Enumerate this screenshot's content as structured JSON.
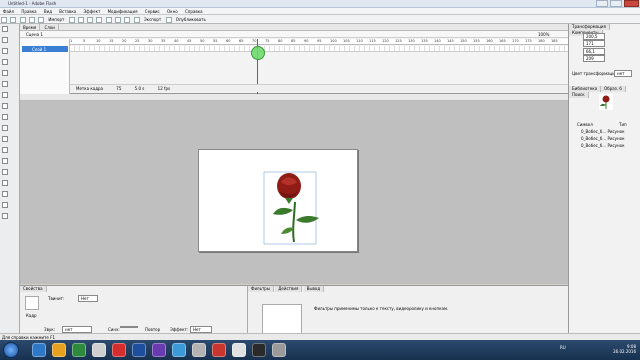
{
  "window": {
    "title": "Untitled-1 - Adobe Flash"
  },
  "menu": [
    "Файл",
    "Правка",
    "Вид",
    "Вставка",
    "Эффект",
    "Модификация",
    "Сервис",
    "Окно",
    "Справка"
  ],
  "toolbar": {
    "import_label": "Импорт",
    "export_label": "Экспорт",
    "publish_label": "Опубликовать"
  },
  "timeline": {
    "tabs": [
      "Время",
      "Слои"
    ],
    "scene": "Сцена 1",
    "zoom": "100%",
    "layer_name": "Слой 1",
    "ruler": [
      "1",
      "5",
      "10",
      "15",
      "20",
      "25",
      "30",
      "35",
      "40",
      "45",
      "50",
      "55",
      "60",
      "65",
      "70",
      "75",
      "80",
      "85",
      "90",
      "95",
      "100",
      "105",
      "110",
      "115",
      "120",
      "125",
      "130",
      "135",
      "140",
      "145",
      "150",
      "155",
      "160",
      "165",
      "170",
      "175",
      "180",
      "185"
    ],
    "playhead_frame": "75",
    "status": [
      "Метка кадра",
      "75",
      "5.0 s",
      "12 fps"
    ]
  },
  "properties": {
    "tabs": [
      "Свойства"
    ],
    "type_label": "Твинит:",
    "type_value": "Нет",
    "frame_label": "Кадр",
    "sound_label": "Звук:",
    "sound_value": "нет",
    "sync_label": "Синх:",
    "repeat_label": "Повтор",
    "effect_label": "Эффект:",
    "effect_value": "Нет"
  },
  "filters": {
    "tabs": [
      "Фильтры",
      "Действия",
      "Вывод"
    ],
    "note": "Фильтры применимы только к тексту, видеоролику и кнопкам."
  },
  "transform": {
    "tabs": [
      "Трансформация",
      "Компоненты"
    ],
    "fields": [
      "200,5",
      "171",
      "66,1",
      "209"
    ],
    "color_label": "Цвет трансформации:",
    "color_value": "нет"
  },
  "library": {
    "tabs": [
      "Библиотека",
      "Образ. б",
      "Поиск"
    ],
    "col_name": "Символ",
    "col_type": "Тип",
    "items": [
      {
        "name": "0_Вобес_б...",
        "type": "Рисунок"
      },
      {
        "name": "0_Вобес_б...",
        "type": "Рисунок"
      },
      {
        "name": "0_Вобес_б...",
        "type": "Рисунок"
      }
    ]
  },
  "statusbar": {
    "text": "Для справки нажмите F1"
  },
  "clock": {
    "time": "9:08",
    "date": "26.02.2016"
  },
  "tray": {
    "lang": "RU"
  },
  "colors": {
    "rose_red": "#8f1d16",
    "leaf_green": "#3b7a2d",
    "select_blue": "#3b7fd5"
  }
}
